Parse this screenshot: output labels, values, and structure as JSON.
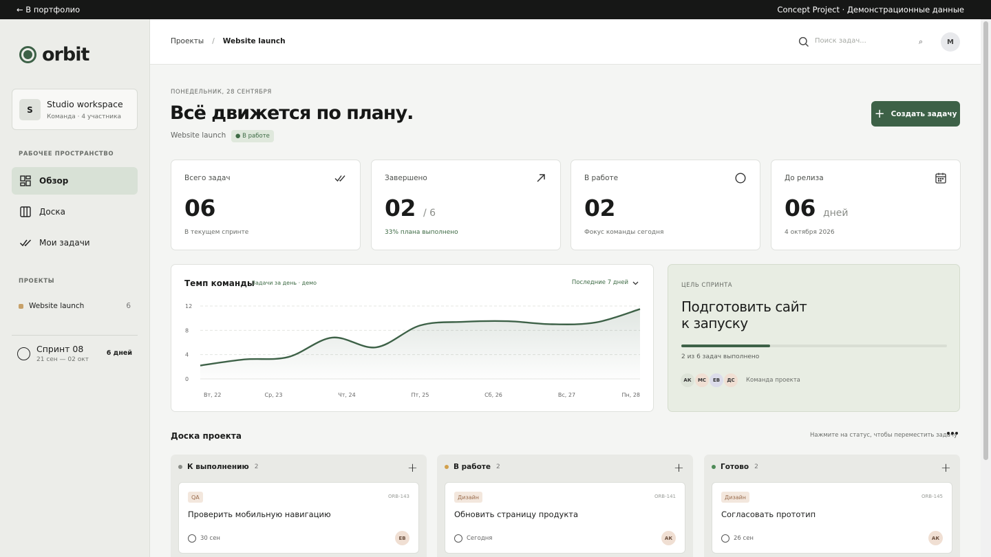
{
  "topbar": {
    "back": "← В портфолио",
    "info": "Concept Project · Демонстрационные данные"
  },
  "sidebar": {
    "logo": "orbit",
    "workspace": {
      "initial": "S",
      "name": "Studio workspace",
      "sub": "Команда · 4 участника"
    },
    "section_workspace": "РАБОЧЕЕ ПРОСТРАНСТВО",
    "nav": [
      {
        "label": "Обзор",
        "icon": "dashboard-icon",
        "active": true
      },
      {
        "label": "Доска",
        "icon": "board-icon",
        "active": false
      },
      {
        "label": "Мои задачи",
        "icon": "check-icon",
        "active": false
      }
    ],
    "section_projects": "ПРОЕКТЫ",
    "project": {
      "name": "Website launch",
      "count": "6",
      "color": "#c7a169"
    },
    "sprint": {
      "name": "Спринт 08",
      "dates": "21 сен — 02 окт",
      "days": "6 дней"
    }
  },
  "header": {
    "breadcrumb": {
      "root": "Проекты",
      "sep": "/",
      "current": "Website launch"
    },
    "search_placeholder": "Поиск задач...",
    "search_shortcut": "⌕",
    "avatar": "M"
  },
  "main": {
    "date": "ПОНЕДЕЛЬНИК, 28 СЕНТЯБРЯ",
    "title": "Всё движется по плану.",
    "project": "Website launch",
    "status": "● В работе",
    "cta": "Создать задачу",
    "kpis": [
      {
        "label": "Всего задач",
        "value": "06",
        "suffix": "",
        "note": "В текущем спринте",
        "icon": "double-check-icon"
      },
      {
        "label": "Завершено",
        "value": "02",
        "suffix": "/ 6",
        "note": "33% плана выполнено",
        "icon": "arrow-up-right-icon"
      },
      {
        "label": "В работе",
        "value": "02",
        "suffix": "",
        "note": "Фокус команды сегодня",
        "icon": "circle-icon"
      },
      {
        "label": "До релиза",
        "value": "06",
        "suffix": "дней",
        "note": "4 октября 2026",
        "icon": "calendar-icon"
      }
    ],
    "chart": {
      "title": "Темп команды",
      "subtitle": "Задачи за день · демо",
      "range": "Последние 7 дней"
    },
    "goal": {
      "label": "ЦЕЛЬ СПРИНТА",
      "title_line1": "Подготовить сайт",
      "title_line2": "к запуску",
      "progress": 0.333,
      "progress_text": "2 из 6 задач выполнено",
      "team": [
        {
          "initials": "АК",
          "color": "#dde3d8"
        },
        {
          "initials": "МС",
          "color": "#f0dfd3"
        },
        {
          "initials": "ЕВ",
          "color": "#dcdcea"
        },
        {
          "initials": "ДС",
          "color": "#f0dfd3"
        }
      ],
      "team_label": "Команда проекта"
    },
    "board": {
      "title": "Доска проекта",
      "hint": "Нажмите на статус, чтобы переместить задачу",
      "columns": [
        {
          "name": "К выполнению",
          "count": "2",
          "color": "#8a8d88",
          "card": {
            "tag": "QA",
            "id": "ORB-143",
            "title": "Проверить мобильную навигацию",
            "due": "30 сен",
            "assignee": "ЕВ"
          }
        },
        {
          "name": "В работе",
          "count": "2",
          "color": "#d2a04b",
          "card": {
            "tag": "Дизайн",
            "id": "ORB-141",
            "title": "Обновить страницу продукта",
            "due": "Сегодня",
            "assignee": "АК"
          }
        },
        {
          "name": "Готово",
          "count": "2",
          "color": "#4e8a57",
          "card": {
            "tag": "Дизайн",
            "id": "ORB-145",
            "title": "Согласовать прототип",
            "due": "26 сен",
            "assignee": "АК"
          }
        }
      ]
    }
  },
  "chart_data": {
    "type": "area",
    "title": "Темп команды",
    "subtitle": "Задачи за день · демо",
    "categories": [
      "Вт, 22",
      "Ср, 23",
      "Чт, 24",
      "Пт, 25",
      "Сб, 26",
      "Вс, 27",
      "Пн, 28"
    ],
    "x_fine": [
      0,
      0.5,
      1,
      1.5,
      2,
      2.5,
      3,
      3.5,
      4,
      4.5,
      5,
      5.5,
      6
    ],
    "values": [
      2.2,
      3.5,
      3.6,
      6.8,
      5.2,
      9.3,
      9.5,
      9.6,
      9.0,
      9.3,
      11.5
    ],
    "series": [
      {
        "values": [
          2.2,
          3.2,
          3.6,
          6.8,
          5.2,
          8.8,
          9.4,
          9.5,
          9.0,
          9.3,
          11.5
        ]
      }
    ],
    "yticks": [
      "12",
      "8",
      "4",
      "0"
    ],
    "ylim": [
      0,
      12
    ],
    "grid": true,
    "color": "#3d6147"
  }
}
